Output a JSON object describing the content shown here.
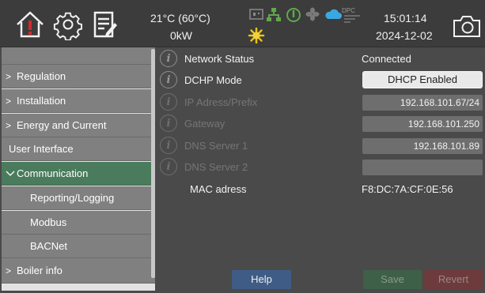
{
  "header": {
    "temperature": "21°C (60°C)",
    "power": "0kW",
    "time": "15:01:14",
    "date": "2024-12-02",
    "dpc_label": "DPC",
    "icons": [
      "home-alarm-icon",
      "gear-icon",
      "notes-icon",
      "camera-icon"
    ],
    "status_icons": [
      "plug-icon",
      "network-icon",
      "power-icon",
      "fan-icon",
      "cloud-icon",
      "sun-icon"
    ]
  },
  "sidebar": {
    "items": [
      {
        "label": "Regulation",
        "chevron": ">"
      },
      {
        "label": "Installation",
        "chevron": ">"
      },
      {
        "label": "Energy and Current",
        "chevron": ">"
      },
      {
        "label": "User Interface",
        "chevron": ""
      },
      {
        "label": "Communication",
        "chevron": "v",
        "active": true
      },
      {
        "label": "Reporting/Logging",
        "chevron": "",
        "sub": true
      },
      {
        "label": "Modbus",
        "chevron": "",
        "sub": true
      },
      {
        "label": "BACNet",
        "chevron": "",
        "sub": true
      },
      {
        "label": "Boiler info",
        "chevron": ">"
      }
    ]
  },
  "main": {
    "network_status": {
      "label": "Network Status",
      "value": "Connected"
    },
    "dhcp_mode": {
      "label": "DCHP Mode",
      "value": "DHCP Enabled"
    },
    "ip_address": {
      "label": "IP Adress/Prefix",
      "value": "192.168.101.67/24"
    },
    "gateway": {
      "label": "Gateway",
      "value": "192.168.101.250"
    },
    "dns1": {
      "label": "DNS Server 1",
      "value": "192.168.101.89"
    },
    "dns2": {
      "label": "DNS Server 2",
      "value": ""
    },
    "mac": {
      "label": "MAC adress",
      "value": "F8:DC:7A:CF:0E:56"
    },
    "info_glyph": "i"
  },
  "buttons": {
    "help": "Help",
    "save": "Save",
    "revert": "Revert"
  },
  "colors": {
    "active_item": "#4a7b5c",
    "help_button": "#3f5c86",
    "save_button": "#3f6048",
    "revert_button": "#6d3b3b",
    "alarm_red": "#d42a2a"
  }
}
